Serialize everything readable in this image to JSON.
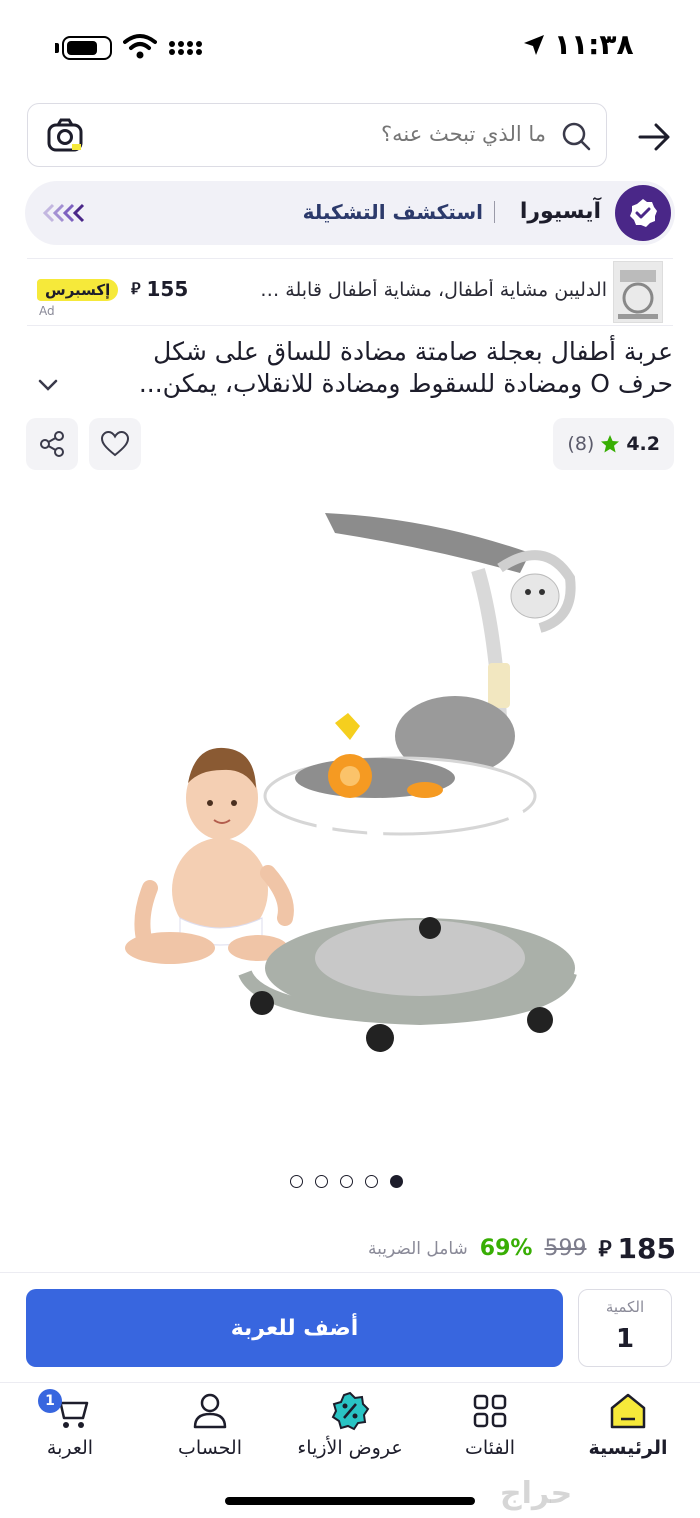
{
  "status_bar": {
    "time": "١١:٣٨"
  },
  "search": {
    "placeholder": "ما الذي تبحث عنه؟"
  },
  "brand_bar": {
    "brand": "آيسيورا",
    "explore": "استكشف التشكيلة"
  },
  "ad": {
    "text": "الدليبن مشاية أطفال، مشاية أطفال قابلة ل...",
    "price": "155",
    "express": "إكسبرس",
    "ad_label": "Ad"
  },
  "product": {
    "title_line1": "عربة أطفال بعجلة صامتة مضادة للساق على شكل",
    "title_line2": "حرف O ومضادة للسقوط ومضادة للانقلاب، يمكن...",
    "rating": "4.2",
    "rating_count": "(8)",
    "image_count": 5,
    "active_image": 5
  },
  "price": {
    "current": "185",
    "old": "599",
    "discount": "69%",
    "tax_note": "شامل الضريبة",
    "currency_symbol": "⃁"
  },
  "cart_action": {
    "button": "أضف للعربة",
    "qty_label": "الكمية",
    "qty_value": "1"
  },
  "nav": {
    "home": "الرئيسية",
    "categories": "الفئات",
    "fashion": "عروض الأزياء",
    "account": "الحساب",
    "cart": "العربة",
    "cart_count": "1"
  },
  "watermark": "حراج",
  "colors": {
    "primary_blue": "#3866df",
    "brand_purple": "#4a2788",
    "yellow": "#f6e93a",
    "discount_green": "#38ae04"
  }
}
